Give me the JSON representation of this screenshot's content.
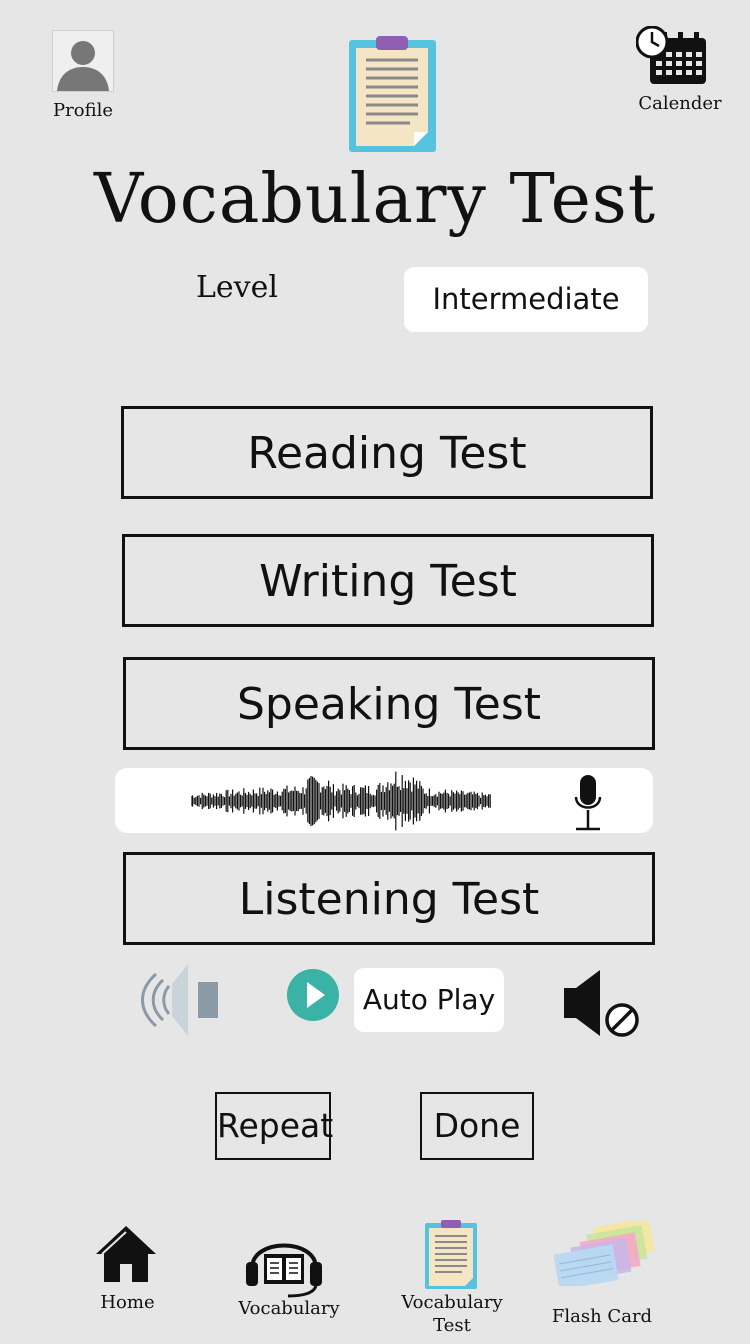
{
  "header": {
    "profile_label": "Profile",
    "calendar_label": "Calender",
    "title": "Vocabulary Test"
  },
  "level": {
    "label": "Level",
    "value": "Intermediate"
  },
  "tests": {
    "reading": "Reading Test",
    "writing": "Writing Test",
    "speaking": "Speaking Test",
    "listening": "Listening Test"
  },
  "audio": {
    "autoplay_label": "Auto Play"
  },
  "actions": {
    "repeat": "Repeat",
    "done": "Done"
  },
  "nav": {
    "home": "Home",
    "vocabulary": "Vocabulary",
    "vocab_test_line1": "Vocabulary",
    "vocab_test_line2": "Test",
    "flash_card": "Flash Card"
  },
  "colors": {
    "background": "#e6e6e6",
    "play_button": "#3ab3a6",
    "clipboard_frame": "#55c3df",
    "clipboard_clip": "#8e5fb5"
  }
}
